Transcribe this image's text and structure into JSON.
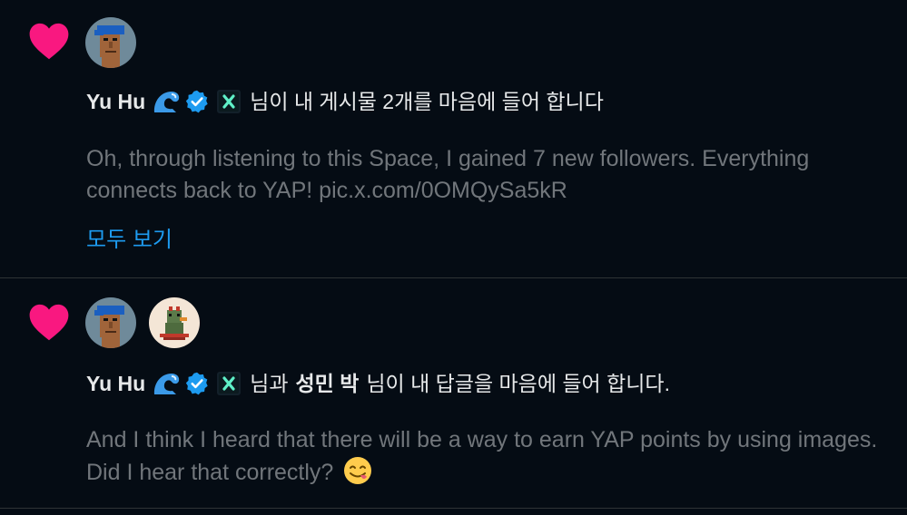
{
  "notifications": [
    {
      "user_name": "Yu Hu",
      "action": "님이 내 게시물 2개를 마음에 들어 합니다",
      "preview": "Oh, through listening to this Space, I gained 7 new followers. Everything connects back to YAP! pic.x.com/0OMQySa5kR",
      "show_all": "모두 보기"
    },
    {
      "user_name": "Yu Hu",
      "connector": "님과",
      "second_user": "성민 박",
      "action": "님이 내 답글을 마음에 들어 합니다.",
      "preview": "And I think I heard that there will be a way to earn YAP points by using images. Did I hear that correctly?"
    }
  ],
  "icons": {
    "like": "heart-icon",
    "wave": "wave-emoji",
    "verified": "verified-badge-icon",
    "affiliate": "x-affiliate-badge",
    "emoji": "yum-face-emoji"
  },
  "colors": {
    "background": "#050c14",
    "heart": "#f91880",
    "link": "#1d9bf0",
    "muted_text": "#71767b",
    "divider": "#2f3336"
  }
}
